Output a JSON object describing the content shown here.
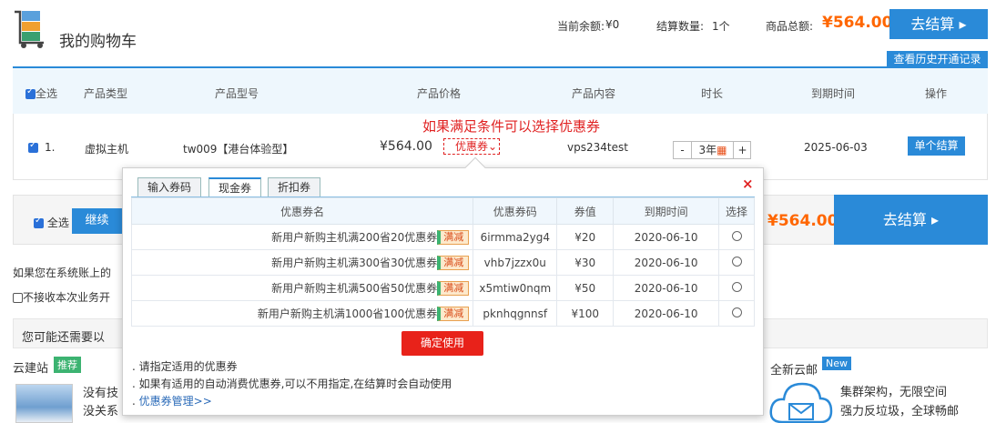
{
  "header": {
    "title": "我的购物车",
    "balance_label": "当前余额:",
    "balance_value": "¥0",
    "count_label": "结算数量:",
    "count_value": "1个",
    "total_label": "商品总额:",
    "total_value": "¥564.00",
    "checkout_label": "去结算",
    "history_label": "查看历史开通记录"
  },
  "table": {
    "headers": [
      "全选",
      "产品类型",
      "产品型号",
      "产品价格",
      "产品内容",
      "时长",
      "到期时间",
      "操作"
    ]
  },
  "row": {
    "index": "1.",
    "type": "虚拟主机",
    "model": "tw009【港台体验型】",
    "price": "¥564.00",
    "coupon_label": "优惠券",
    "content": "vps234test",
    "qty_minus": "-",
    "qty_value": "3年",
    "qty_plus": "+",
    "expire": "2025-06-03",
    "action": "单个结算",
    "promo_hint": "如果满足条件可以选择优惠券"
  },
  "footer": {
    "select_all": "全选",
    "continue_label": "继续",
    "total_value": "¥564.00",
    "checkout_label": "去结算",
    "note1": "如果您在系统账上的",
    "note2": "不接收本次业务开"
  },
  "maybe": {
    "text": "您可能还需要以",
    "cloud_site": "云建站",
    "badge_rec": "推荐",
    "promo_title_1": "没有技",
    "promo_title_2": "没关系",
    "new_cloud": "全新云邮",
    "badge_new": "New",
    "cloud_line1": "集群架构，无限空间",
    "cloud_line2": "强力反垃圾，全球畅邮"
  },
  "popup": {
    "tabs": [
      "输入券码",
      "现金券",
      "折扣券"
    ],
    "active_tab": "现金券",
    "columns": [
      "优惠券名",
      "优惠券码",
      "券值",
      "到期时间",
      "选择"
    ],
    "coupons": [
      {
        "name": "新用户新购主机满200省20优惠券",
        "tag": "满减",
        "code": "6irmma2yg4",
        "value": "¥20",
        "expire": "2020-06-10"
      },
      {
        "name": "新用户新购主机满300省30优惠券",
        "tag": "满减",
        "code": "vhb7jzzx0u",
        "value": "¥30",
        "expire": "2020-06-10"
      },
      {
        "name": "新用户新购主机满500省50优惠券",
        "tag": "满减",
        "code": "x5mtiw0nqm",
        "value": "¥50",
        "expire": "2020-06-10"
      },
      {
        "name": "新用户新购主机满1000省100优惠券",
        "tag": "满减",
        "code": "pknhqgnnsf",
        "value": "¥100",
        "expire": "2020-06-10"
      }
    ],
    "confirm_label": "确定使用",
    "note1": ". 请指定适用的优惠券",
    "note2": ". 如果有适用的自动消费优惠券,可以不用指定,在结算时会自动使用",
    "manage_link": "优惠券管理>>",
    "close_symbol": "×"
  },
  "colors": {
    "accent": "#2a8ad8",
    "price": "#ff6600",
    "alert": "#e02222"
  }
}
